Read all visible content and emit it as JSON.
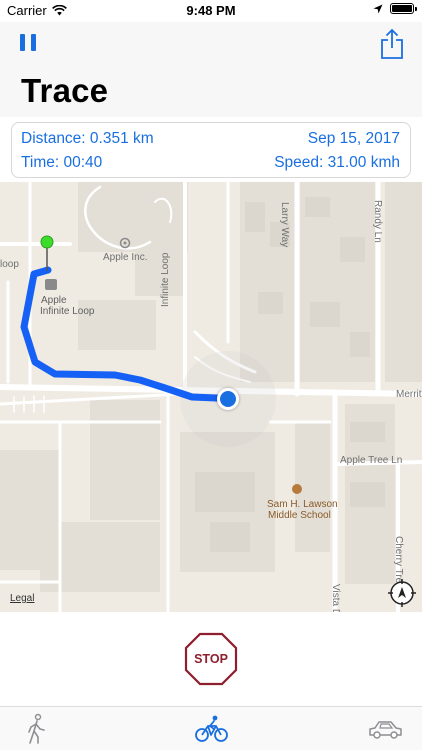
{
  "status_bar": {
    "carrier": "Carrier",
    "time": "9:48 PM",
    "icons": [
      "wifi-icon",
      "location-arrow-icon",
      "battery-icon"
    ]
  },
  "nav": {
    "title": "Trace",
    "left_button_icon": "pause-icon",
    "right_button_icon": "share-icon"
  },
  "stats": {
    "distance": "Distance: 0.351 km",
    "date": "Sep 15, 2017",
    "time": "Time: 00:40",
    "speed": "Speed: 31.00 kmh"
  },
  "map": {
    "labels": {
      "apple_inc": "Apple Inc.",
      "apple": "Apple",
      "infinite_loop_poi": "Infinite Loop",
      "loop": "loop",
      "infinite_loop_street": "Infinite Loop",
      "larry_way": "Larry Way",
      "randy_ln": "Randy Ln",
      "merritt": "Merritt",
      "apple_tree_ln": "Apple Tree Ln",
      "school_line1": "Sam H. Lawson",
      "school_line2": "Middle School",
      "cherry_tree": "Cherry Tre",
      "vista_dr": "Vista D"
    },
    "legal": "Legal",
    "route_color": "#1560f5",
    "start_pin_color": "#3ddc2a",
    "current_location_color": "#1a6fe0"
  },
  "stop_button": {
    "label": "STOP",
    "color": "#8e1f2e"
  },
  "tabs": [
    {
      "name": "walk",
      "icon": "walking-icon",
      "active": false
    },
    {
      "name": "bike",
      "icon": "bicycle-icon",
      "active": true
    },
    {
      "name": "car",
      "icon": "car-icon",
      "active": false
    }
  ],
  "colors": {
    "accent": "#1a6fe0",
    "stop": "#8e1f2e",
    "map_background": "#efebe3"
  }
}
